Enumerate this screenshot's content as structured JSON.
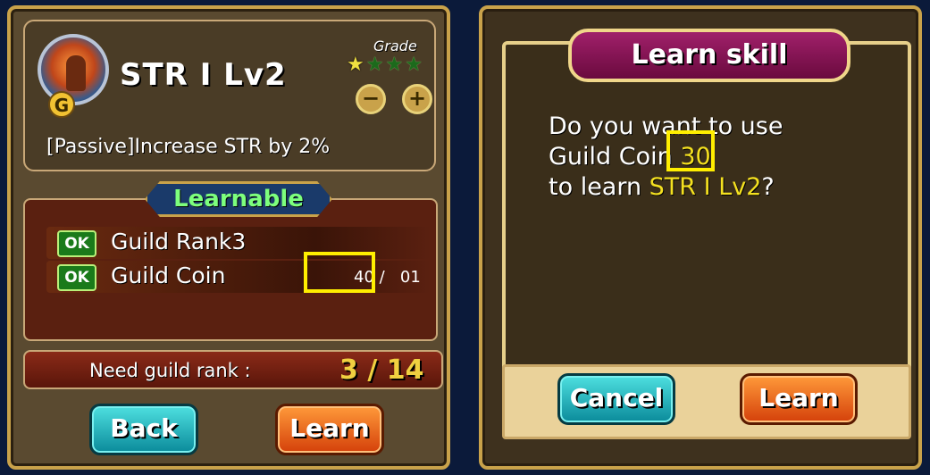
{
  "skill": {
    "title": "STR  I Lv2",
    "grade_label": "Grade",
    "stars_filled": 1,
    "stars_total": 4,
    "description": "[Passive]Increase STR by 2%",
    "icon": "fire-warrior-icon",
    "icon_badge": "G"
  },
  "grade_controls": {
    "minus": "−",
    "plus": "+"
  },
  "requirements": {
    "header": "Learnable",
    "items": [
      {
        "status": "OK",
        "label": "Guild Rank3",
        "value": ""
      },
      {
        "status": "OK",
        "label": "Guild Coin",
        "value": "40 / 101"
      }
    ],
    "coin_visible_left": "40 /",
    "coin_visible_right": "01"
  },
  "rank": {
    "label": "Need guild rank :",
    "value": "3 / 14"
  },
  "buttons": {
    "back": "Back",
    "learn": "Learn"
  },
  "dialog": {
    "title": "Learn skill",
    "line1": "Do you want to use",
    "line2_prefix": "Guild Coin ",
    "cost": "30",
    "line3_prefix": "to learn ",
    "skill_name": "STR  I Lv2",
    "line3_suffix": "?",
    "cancel": "Cancel",
    "learn": "Learn"
  },
  "colors": {
    "panel_bg": "#5a4a30",
    "frame": "#c9a24a",
    "highlight": "#ffee00",
    "accent_green": "#7dff7d",
    "accent_yellow": "#f4e020"
  }
}
